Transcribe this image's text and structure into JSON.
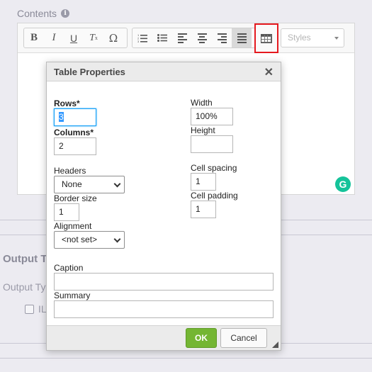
{
  "page": {
    "contents_label": "Contents",
    "output_title": "Output T",
    "output_type_label": "Output Ty",
    "checkbox_label": "IL"
  },
  "toolbar": {
    "styles_placeholder": "Styles",
    "buttons": [
      "bold-icon",
      "italic-icon",
      "underline-icon",
      "remove-format-icon",
      "special-char-icon",
      "numbered-list-icon",
      "bulleted-list-icon",
      "align-left-icon",
      "align-center-icon",
      "align-right-icon",
      "justify-icon",
      "table-icon"
    ],
    "highlight_color": "#e5191f"
  },
  "dialog": {
    "title": "Table Properties",
    "close": "✕",
    "rows_label": "Rows*",
    "rows_value": "3",
    "columns_label": "Columns*",
    "columns_value": "2",
    "headers_label": "Headers",
    "headers_value": "None",
    "border_size_label": "Border size",
    "border_size_value": "1",
    "alignment_label": "Alignment",
    "alignment_value": "<not set>",
    "width_label": "Width",
    "width_value": "100%",
    "height_label": "Height",
    "height_value": "",
    "cell_spacing_label": "Cell spacing",
    "cell_spacing_value": "1",
    "cell_padding_label": "Cell padding",
    "cell_padding_value": "1",
    "caption_label": "Caption",
    "caption_value": "",
    "summary_label": "Summary",
    "summary_value": "",
    "ok_label": "OK",
    "cancel_label": "Cancel",
    "ok_color": "#74b633"
  }
}
